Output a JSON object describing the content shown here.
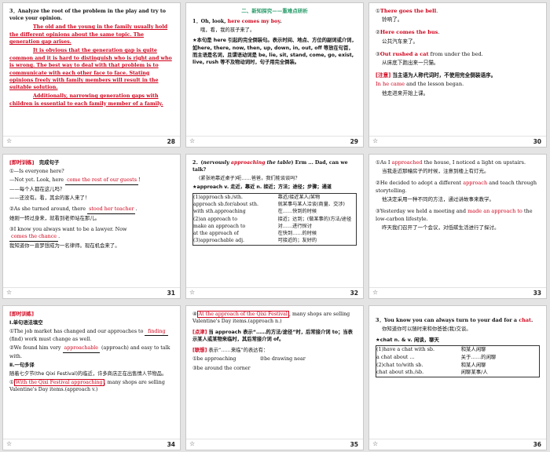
{
  "slides": [
    {
      "page": "28",
      "question": "3．Analyze the root of the problem in the play and try to voice your opinion.",
      "answer_lines": [
        "The old and the young in the family usually hold the different opinions about the same topic. The generation gap arises.",
        "It is obvious that the generation gap is quite common and it is hard to distinguish who is right and who is wrong. The best way to deal with that problem is to communicate with each other face to face. Stating opinions freely with family members will result in the suitable solution.",
        "Additionally, narrowing generation gaps with children is essential to each family member of a family."
      ]
    },
    {
      "page": "29",
      "section_title": "二、新知探究——重难点研析",
      "item1_prefix": "1．Oh, look, ",
      "item1_highlight": "here comes my boy",
      "item1_suffix": ".",
      "item1_cn": "哦，看，我的孩子来了。",
      "note": "★本句是 here 引起的完全倒装句。表示时间、地点、方位的副词或介词，如here, there, now, then, up, down, in, out, off 等放在句首，而主语是名词，且谓语动词是 be, lie, sit, stand, come, go, exist, live, rush 等不及物动词时，句子用完全倒装。"
    },
    {
      "page": "30",
      "lines": [
        {
          "num": "①",
          "red": "There goes the bell",
          "rest": ".",
          "cn": "铃响了。"
        },
        {
          "num": "②",
          "red": "Here comes the bus",
          "rest": ".",
          "cn": "公共汽车来了。"
        },
        {
          "num": "③",
          "red": "Out rushed a cat",
          "rest": " from under the bed.",
          "cn": "从床底下跑出来一只猫。"
        }
      ],
      "note_tag": "[注意]",
      "note_text": "当主语为人称代词时，不使用完全倒装语序。",
      "example_red": "In he came",
      "example_rest": " and the lesson began.",
      "example_cn": "他走进来开始上课。"
    },
    {
      "page": "31",
      "tag": "[即时训练]",
      "title": "完成句子",
      "q1_a": "①—Is everyone here?",
      "q1_b_pre": "—Not yet. Look, here ",
      "q1_b_blank": "come the rest of our guests",
      "q1_b_post": "!",
      "q1_cn1": "——每个人都在这儿吗？",
      "q1_cn2": "——还没有。看，其余的客人来了！",
      "q2_pre": "②As she turned around, there ",
      "q2_blank": "stood her teacher",
      "q2_post": ".",
      "q2_cn": "她刚一转过身来，就看到老师站在那儿。",
      "q3_pre": "③I know you always want to be a lawyer. Now ",
      "q3_blank": "comes the chance",
      "q3_post": ".",
      "q3_cn": "我知道你一直梦想成为一名律师。现在机会来了。"
    },
    {
      "page": "32",
      "item_prefix": "2．(",
      "item_italic": "nervously ",
      "item_red": "approaching",
      "item_italic2": " the table",
      "item_suffix": ") Erm ... Dad, can we talk?",
      "item_cn": "(紧张地靠近桌子)呃……爸爸，我们能谈谈吗？",
      "star_line": "★approach v. 走近，靠近 n. 接近；方法；途径；步骤；通道",
      "table": [
        {
          "en": "(1)approach sb./sth.",
          "cn": "靠近/接近某人/某物"
        },
        {
          "en": "approach sb.for/about sth.",
          "cn": "就某事与某人洽谈(商量、交涉)"
        },
        {
          "en": "with sth.approaching",
          "cn": "在……快到的时候"
        },
        {
          "en": "(2)an approach to",
          "cn": "接近；达到；(做某事的)方法/途径"
        },
        {
          "en": "make an approach to",
          "cn": "对……进行探讨"
        },
        {
          "en": "at the approach of",
          "cn": "在快到……的时候"
        },
        {
          "en": "(3)approachable adj.",
          "cn": "可接近的；友好的"
        }
      ]
    },
    {
      "page": "33",
      "items": [
        {
          "num": "①As I ",
          "red": "approached",
          "rest": " the house, I noticed a light on upstairs.",
          "cn": "当我走近那幢房子的时候，注意到楼上有灯光。"
        },
        {
          "num": "②He decided to adopt a different ",
          "red": "approach",
          "rest": " and teach through storytelling.",
          "cn": "他决定采用一种不同的方法，通过讲故事来教学。"
        },
        {
          "num": "③Yesterday we held a meeting and ",
          "red": "made an approach to",
          "rest": " the low-carbon lifestyle.",
          "cn": "昨天我们召开了一个会议，对低碳生活进行了探讨。"
        }
      ]
    },
    {
      "page": "34",
      "tag": "[即时训练]",
      "part1": "Ⅰ.单句语法填空",
      "q1_pre": "①The job market has changed and our approaches to ",
      "q1_blank": "finding",
      "q1_post": " (find) work must change as well.",
      "q2_pre": "②We found him very ",
      "q2_blank": "approachable",
      "q2_post": " (approach) and easy to talk with.",
      "part2": "Ⅱ.一句多译",
      "cn_sentence": "随着七夕节(the Qixi Festival)的临近，许多商店正在出售情人节物品。",
      "q3_blank": "With the Qixi Festival approaching",
      "q3_post": ", many shops are selling Valentine's Day items.(approach v.)"
    },
    {
      "page": "35",
      "q4_num": "④",
      "q4_blank": "At the approach of the Qixi Festival",
      "q4_post": ", many shops are selling Valentine's Day items.(approach n.)",
      "note_tag": "[点津]",
      "note_text": "当 approach 表示“……的方法/途径”时，后常接介词 to；当表示某人或某物来临时，其后常接介词 of。",
      "link_tag": "[联想]",
      "link_text": "表示“……来临”的表达有：",
      "phrases": [
        "①be approaching",
        "②be drawing near",
        "③be around the corner"
      ]
    },
    {
      "page": "36",
      "item_pre": "3．You know you can always turn to your dad for a ",
      "item_red": "chat",
      "item_post": ".",
      "item_cn": "你知道你可以随时来和你爸爸(我)交谈。",
      "star_line": "★chat n. & v. 闲谈，聊天",
      "table": [
        {
          "en": "(1)have a chat with sb.",
          "cn": "和某人闲聊"
        },
        {
          "en": "a chat about ...",
          "cn": "关于……的闲聊"
        },
        {
          "en": "(2)chat to/with sb.",
          "cn": "和某人闲聊"
        },
        {
          "en": "chat about sth./sb.",
          "cn": "闲聊某事/人"
        }
      ]
    }
  ]
}
